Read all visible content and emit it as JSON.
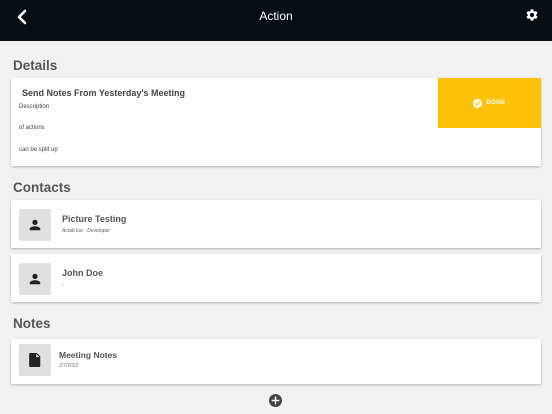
{
  "header": {
    "title": "Action"
  },
  "sections": {
    "details": "Details",
    "contacts": "Contacts",
    "notes": "Notes"
  },
  "action": {
    "title": "Send Notes From Yesterday's Meeting",
    "description_lines": [
      "Description",
      "of actions",
      "can be split up"
    ],
    "done_label": "DONE"
  },
  "contacts": [
    {
      "name": "Picture Testing",
      "subtitle": "Actab lue - Developer"
    },
    {
      "name": "John Doe",
      "subtitle": "-"
    }
  ],
  "notes": [
    {
      "title": "Meeting Notes",
      "date": "2/7/2022"
    }
  ],
  "colors": {
    "header_bg": "#030e16",
    "done_bg": "#fec107",
    "page_bg": "#f1f1f1"
  },
  "icons": {
    "back": "chevron-left-icon",
    "settings": "gear-icon",
    "done": "check-circle-icon",
    "contact": "person-icon",
    "note": "document-icon",
    "add": "plus-circle-icon"
  }
}
